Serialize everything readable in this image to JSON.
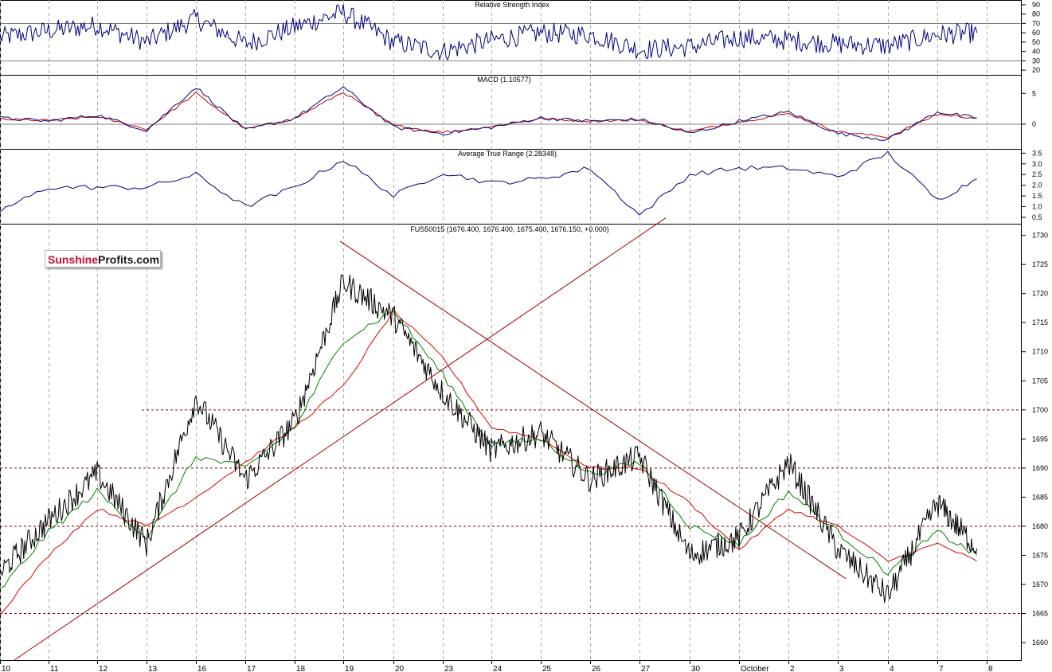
{
  "watermark": {
    "part1": "Sunshine",
    "part2": "Profits.com"
  },
  "x_ticks": [
    "10",
    "11",
    "12",
    "13",
    "16",
    "17",
    "18",
    "19",
    "20",
    "23",
    "24",
    "25",
    "26",
    "27",
    "30",
    "October",
    "2",
    "3",
    "4",
    "7",
    "8"
  ],
  "panels": {
    "rsi": {
      "title": "Relative Strength Index",
      "ticks": [
        "90",
        "80",
        "70",
        "60",
        "50",
        "40",
        "30",
        "20"
      ],
      "levels": [
        70,
        30
      ]
    },
    "macd": {
      "title": "MACD (1.10577)",
      "ticks": [
        "5",
        "0"
      ]
    },
    "atr": {
      "title": "Average True Range (2.28348)",
      "ticks": [
        "3.5",
        "3.0",
        "2.5",
        "2.0",
        "1.5",
        "1.0",
        "0.5"
      ]
    },
    "price": {
      "title": "FUS50015 (1676.400, 1676.400, 1675.400, 1676.150, +0.000)",
      "ticks": [
        "1730",
        "1725",
        "1720",
        "1715",
        "1710",
        "1705",
        "1700",
        "1695",
        "1690",
        "1685",
        "1680",
        "1675",
        "1670",
        "1665",
        "1660"
      ]
    }
  },
  "colors": {
    "price": "#000000",
    "sma_fast": "#008000",
    "sma_slow": "#e00000",
    "trendline": "#a00000",
    "indicator": "#000080",
    "signal": "#c00000",
    "grid": "#a8a8a8"
  },
  "chart_data": [
    {
      "type": "line",
      "title": "Relative Strength Index",
      "ylim": [
        15,
        95
      ],
      "levels": [
        70,
        30
      ],
      "x": [
        "10",
        "11",
        "12",
        "13",
        "16",
        "17",
        "18",
        "19",
        "20",
        "23",
        "24",
        "25",
        "26",
        "27",
        "30",
        "October",
        "2",
        "3",
        "4",
        "7",
        "7.8"
      ],
      "series": [
        {
          "values": [
            55,
            62,
            68,
            50,
            75,
            48,
            66,
            82,
            50,
            40,
            52,
            60,
            58,
            42,
            45,
            55,
            52,
            48,
            46,
            58,
            60
          ]
        }
      ]
    },
    {
      "type": "line",
      "title": "MACD (1.10577)",
      "ylim": [
        -4,
        8
      ],
      "x": [
        "10",
        "11",
        "12",
        "13",
        "16",
        "17",
        "18",
        "19",
        "20",
        "23",
        "24",
        "25",
        "26",
        "27",
        "30",
        "October",
        "2",
        "3",
        "4",
        "7",
        "7.8"
      ],
      "series": [
        {
          "values": [
            1.0,
            0.5,
            1.5,
            -1.0,
            6.0,
            -1.0,
            1.0,
            6.0,
            -0.5,
            -1.5,
            -0.5,
            1.0,
            0.5,
            0.8,
            -1.5,
            0.5,
            2.0,
            -1.5,
            -2.5,
            2.0,
            1.0
          ]
        },
        {
          "values": [
            0.8,
            0.6,
            1.2,
            -0.8,
            5.0,
            -0.8,
            0.9,
            5.2,
            -0.2,
            -1.3,
            -0.4,
            0.9,
            0.5,
            0.7,
            -1.2,
            0.4,
            1.7,
            -1.2,
            -2.1,
            1.6,
            1.0
          ]
        }
      ]
    },
    {
      "type": "line",
      "title": "Average True Range (2.28348)",
      "ylim": [
        0.2,
        3.7
      ],
      "x": [
        "10",
        "11",
        "12",
        "13",
        "16",
        "17",
        "18",
        "19",
        "20",
        "23",
        "24",
        "25",
        "26",
        "27",
        "30",
        "October",
        "2",
        "3",
        "4",
        "7",
        "7.8"
      ],
      "series": [
        {
          "values": [
            0.8,
            1.9,
            1.9,
            1.9,
            2.5,
            1.0,
            1.9,
            3.2,
            1.5,
            2.6,
            2.1,
            2.3,
            2.8,
            0.6,
            2.5,
            2.8,
            2.8,
            2.4,
            3.5,
            1.3,
            2.3
          ]
        }
      ]
    },
    {
      "type": "line",
      "title": "FUS50015 (1676.400, 1676.400, 1675.400, 1676.150, +0.000)",
      "ylim": [
        1657,
        1732
      ],
      "x": [
        "10",
        "11",
        "12",
        "13",
        "16",
        "17",
        "18",
        "19",
        "20",
        "23",
        "24",
        "25",
        "26",
        "27",
        "30",
        "October",
        "2",
        "3",
        "4",
        "7",
        "7.8"
      ],
      "series": [
        {
          "values": [
            1672,
            1681,
            1689,
            1677,
            1702,
            1688,
            1698,
            1722,
            1716,
            1703,
            1693,
            1696,
            1688,
            1692,
            1675,
            1678,
            1691,
            1676,
            1668,
            1684,
            1676.15
          ]
        },
        {
          "values": [
            1669,
            1679,
            1686,
            1678,
            1692,
            1690,
            1697,
            1712,
            1717,
            1706,
            1694,
            1695,
            1689,
            1691,
            1680,
            1677,
            1686,
            1679,
            1672,
            1679,
            1675
          ]
        },
        {
          "values": [
            1665,
            1675,
            1683,
            1680,
            1685,
            1691,
            1697,
            1704,
            1717,
            1709,
            1697,
            1695,
            1690,
            1690,
            1684,
            1676,
            1683,
            1680,
            1674,
            1677,
            1674
          ]
        }
      ],
      "annotations": [
        {
          "type": "horizontal",
          "value": 1700
        },
        {
          "type": "horizontal",
          "value": 1690
        },
        {
          "type": "horizontal",
          "value": 1680
        },
        {
          "type": "horizontal",
          "value": 1665
        },
        {
          "type": "trendline",
          "from": [
            "10",
            1657
          ],
          "to": [
            "30",
            1733
          ]
        },
        {
          "type": "trendline",
          "from": [
            "19",
            1729
          ],
          "to": [
            "3",
            1671
          ]
        }
      ]
    }
  ]
}
